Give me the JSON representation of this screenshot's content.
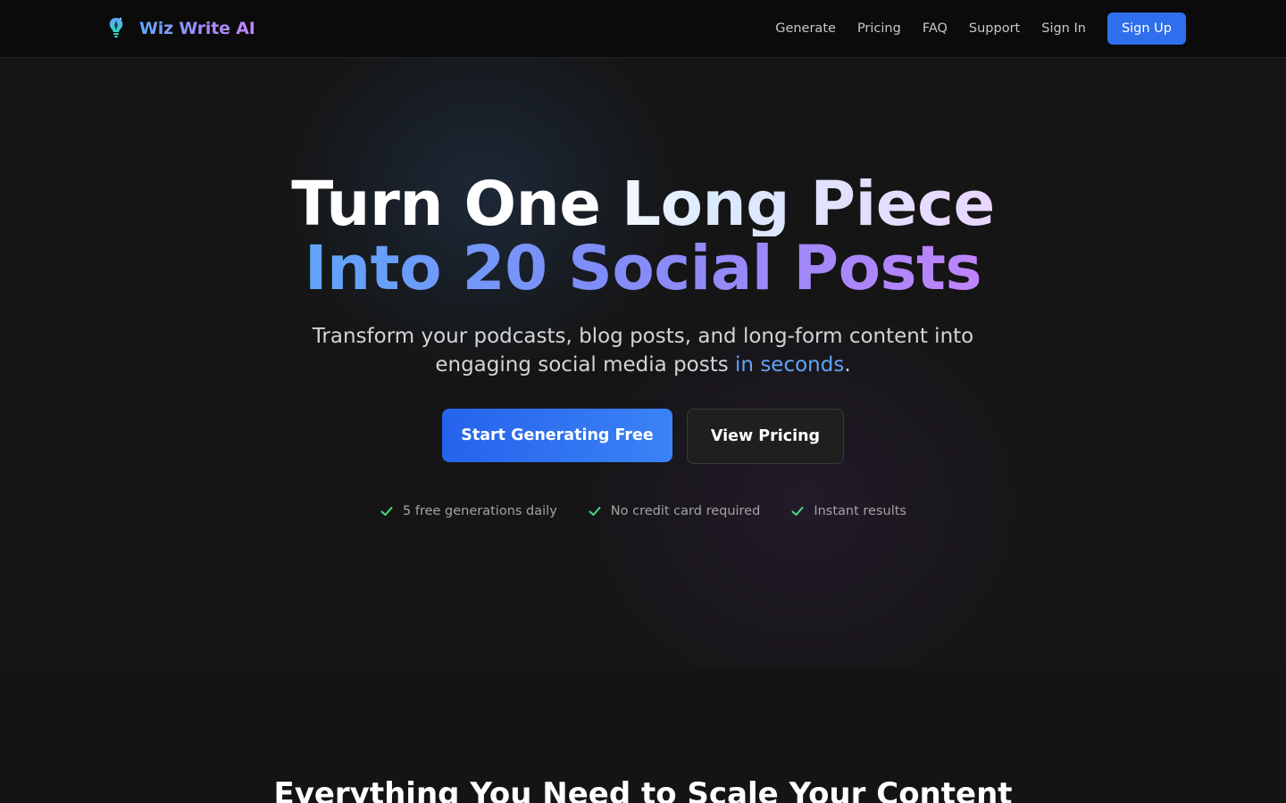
{
  "navbar": {
    "brand": "Wiz Write AI",
    "logo_icon": "lightbulb-pen-icon",
    "links": [
      "Generate",
      "Pricing",
      "FAQ",
      "Support",
      "Sign In"
    ],
    "signup_label": "Sign Up"
  },
  "hero": {
    "headline_line1": "Turn One Long Piece",
    "headline_line2": "Into 20 Social Posts",
    "subtitle_line1": "Transform your podcasts, blog posts, and long-form content into",
    "subtitle_line2_prefix": "engaging social media posts ",
    "subtitle_accent": "in seconds",
    "subtitle_suffix": ".",
    "primary_cta": "Start Generating Free",
    "secondary_cta": "View Pricing",
    "features": [
      {
        "icon": "check-icon",
        "label": "5 free generations daily"
      },
      {
        "icon": "check-icon",
        "label": "No credit card required"
      },
      {
        "icon": "check-icon",
        "label": "Instant results"
      }
    ]
  },
  "next_section": {
    "title": "Everything You Need to Scale Your Content"
  },
  "colors": {
    "accent_blue": "#2f6fed",
    "gradient_purple": "#c084fc",
    "check_green": "#4ade80",
    "background": "#141414"
  }
}
